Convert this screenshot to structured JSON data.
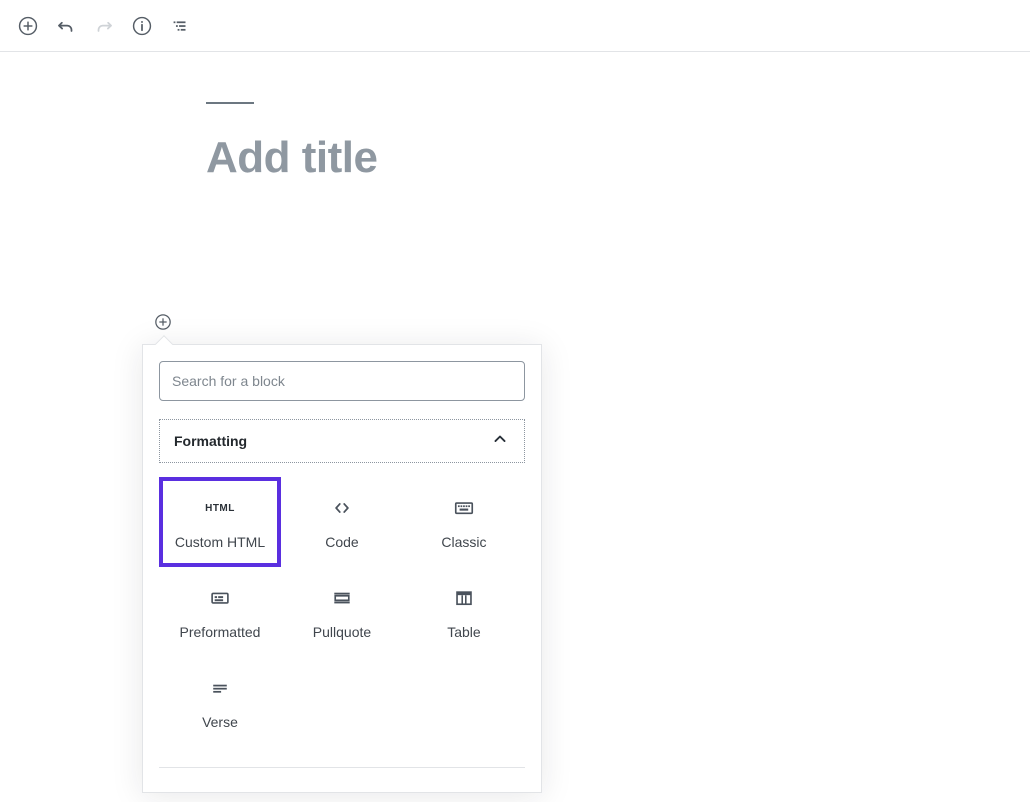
{
  "toolbar": {
    "buttons": [
      {
        "name": "add-block-button",
        "icon": "circle-plus-icon",
        "label": "Add block",
        "disabled": false
      },
      {
        "name": "undo-button",
        "icon": "undo-icon",
        "label": "Undo",
        "disabled": false
      },
      {
        "name": "redo-button",
        "icon": "redo-icon",
        "label": "Redo",
        "disabled": true
      },
      {
        "name": "content-info-button",
        "icon": "info-circle-icon",
        "label": "Content structure",
        "disabled": false
      },
      {
        "name": "block-navigation-button",
        "icon": "list-view-icon",
        "label": "Block navigation",
        "disabled": false
      }
    ]
  },
  "editor": {
    "title_placeholder": "Add title",
    "inserter_toggle_label": "Add block"
  },
  "inserter": {
    "search": {
      "placeholder": "Search for a block",
      "value": ""
    },
    "panel": {
      "title": "Formatting",
      "expanded": true,
      "collapse_icon": "chevron-up-icon"
    },
    "blocks": [
      {
        "label": "Custom HTML",
        "icon": "html-icon",
        "selected": true
      },
      {
        "label": "Code",
        "icon": "angle-brackets-icon",
        "selected": false
      },
      {
        "label": "Classic",
        "icon": "keyboard-icon",
        "selected": false
      },
      {
        "label": "Preformatted",
        "icon": "preformatted-icon",
        "selected": false
      },
      {
        "label": "Pullquote",
        "icon": "pullquote-icon",
        "selected": false
      },
      {
        "label": "Table",
        "icon": "table-icon",
        "selected": false
      },
      {
        "label": "Verse",
        "icon": "verse-icon",
        "selected": false
      }
    ]
  },
  "colors": {
    "selection": "#5a2fe0",
    "border": "#e2e4e7",
    "icon": "#555d66",
    "placeholder_title": "#8f98a1"
  }
}
